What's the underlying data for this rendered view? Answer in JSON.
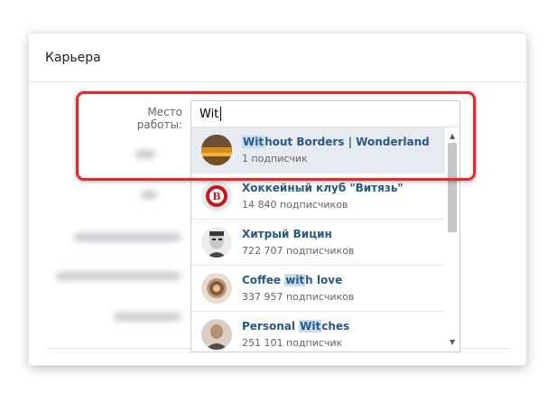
{
  "card": {
    "title": "Карьера"
  },
  "field": {
    "label": "Место работы:",
    "query": "Wit"
  },
  "results": [
    {
      "pre": "",
      "match": "Wit",
      "post": "hout Borders | Wonderland",
      "subscribers": "1 подписчик",
      "icon": "sunset-photo-avatar"
    },
    {
      "pre": "Хоккейный клуб \"Витязь\"",
      "match": "",
      "post": "",
      "subscribers": "14 840 подписчиков",
      "icon": "vityaz-logo-avatar"
    },
    {
      "pre": "Хитрый Вицин",
      "match": "",
      "post": "",
      "subscribers": "722 707 подписчиков",
      "icon": "actor-portrait-avatar"
    },
    {
      "pre": "Coffee ",
      "match": "wit",
      "post": "h love",
      "subscribers": "337 957 подписчиков",
      "icon": "coffee-cup-avatar"
    },
    {
      "pre": "Personal ",
      "match": "Wit",
      "post": "ches",
      "subscribers": "251 101 подписчик",
      "icon": "portrait-photo-avatar"
    }
  ],
  "highlight_color": "#e8262b",
  "link_color": "#2a5885"
}
